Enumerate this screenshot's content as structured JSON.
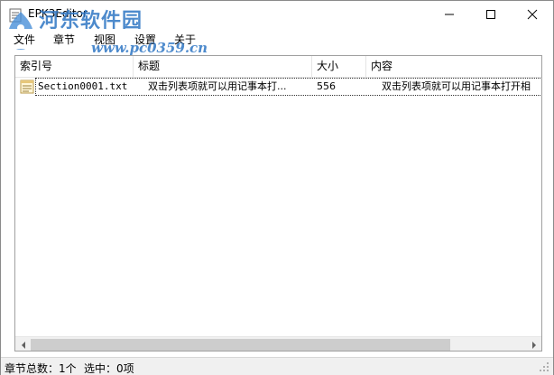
{
  "window": {
    "title": "EPK3Editor",
    "icon": "app-icon",
    "controls": {
      "minimize_icon": "minimize-icon",
      "maximize_icon": "maximize-icon",
      "close_icon": "close-icon"
    }
  },
  "watermark": {
    "name": "河东软件园",
    "url": "www.pc0359.cn"
  },
  "menu": {
    "items": [
      "文件",
      "章节",
      "视图",
      "设置",
      "关于"
    ]
  },
  "list": {
    "columns": [
      "索引号",
      "标题",
      "大小",
      "内容"
    ],
    "rows": [
      {
        "icon": "text-file-icon",
        "index": "Section0001.txt",
        "title": "双击列表项就可以用记事本打...",
        "size": "556",
        "content": "双击列表项就可以用记事本打开相"
      }
    ]
  },
  "status": {
    "total_label": "章节总数：",
    "total_value": "1个",
    "selected_label": "选中：",
    "selected_value": "0项"
  },
  "colors": {
    "watermark": "#2f76c4",
    "scroll_thumb": "#cdcdcd",
    "statusbar_bg": "#f0f0f0"
  }
}
